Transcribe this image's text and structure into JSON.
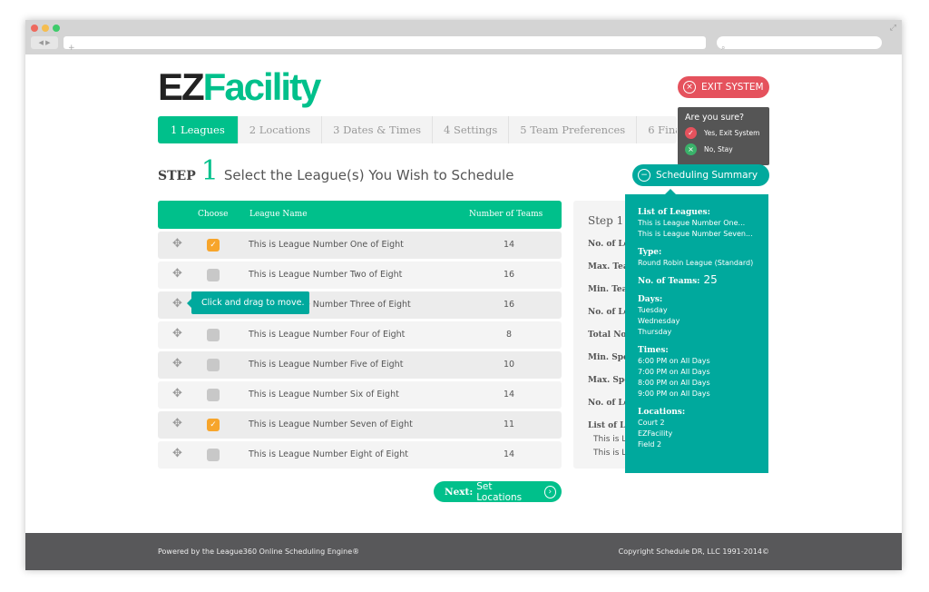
{
  "browser": {
    "back": "◀",
    "forward": "▶",
    "new_tab": "+",
    "search_icon": "search-icon"
  },
  "brand": {
    "logo_part1": "EZ",
    "logo_part2": "Facility",
    "color_dark": "#222222",
    "color_green": "#00c08b"
  },
  "exit": {
    "label": "EXIT SYSTEM",
    "color": "#e5525d",
    "confirm_title": "Are you sure?",
    "yes": "Yes, Exit System",
    "no": "No, Stay"
  },
  "steps": [
    {
      "label": "1 Leagues",
      "active": true
    },
    {
      "label": "2 Locations"
    },
    {
      "label": "3 Dates & Times"
    },
    {
      "label": "4 Settings"
    },
    {
      "label": "5 Team Preferences"
    },
    {
      "label": "6 Finalize"
    }
  ],
  "heading": {
    "step": "STEP",
    "number": "1",
    "title": "Select the League(s) You Wish to Schedule"
  },
  "table": {
    "headers": {
      "choose": "Choose",
      "name": "League Name",
      "teams": "Number of Teams"
    },
    "rows": [
      {
        "name": "This is League Number One of Eight",
        "teams": "14",
        "checked": true
      },
      {
        "name": "This is League Number Two of Eight",
        "teams": "16",
        "checked": false
      },
      {
        "name": "This is League Number Three of Eight",
        "teams": "16",
        "checked": false
      },
      {
        "name": "This is League Number Four of Eight",
        "teams": "8",
        "checked": false
      },
      {
        "name": "This is League Number Five of Eight",
        "teams": "10",
        "checked": false
      },
      {
        "name": "This is League Number Six of Eight",
        "teams": "14",
        "checked": false
      },
      {
        "name": "This is League Number Seven of Eight",
        "teams": "11",
        "checked": true
      },
      {
        "name": "This is League Number Eight of Eight",
        "teams": "14",
        "checked": false
      }
    ],
    "tooltip": "Click and drag to move."
  },
  "step_panel": {
    "title": "Step 1",
    "labels": [
      "No. of Le",
      "Max. Tea",
      "Min. Tea",
      "No. of Le",
      "Total No.",
      "Min. Spo",
      "Max. Spo",
      "No. of Le",
      "List of Le"
    ],
    "items": [
      "This is L",
      "This is L"
    ]
  },
  "summary": {
    "button": "Scheduling Summary",
    "leagues_label": "List of Leagues:",
    "leagues": [
      "This is League Number One...",
      "This is League Number Seven..."
    ],
    "type_label": "Type:",
    "type": "Round Robin League (Standard)",
    "teams_label": "No. of Teams:",
    "teams": "25",
    "days_label": "Days:",
    "days": [
      "Tuesday",
      "Wednesday",
      "Thursday"
    ],
    "times_label": "Times:",
    "times": [
      "6:00 PM on All Days",
      "7:00 PM on All Days",
      "8:00 PM on All Days",
      "9:00 PM on All Days"
    ],
    "locations_label": "Locations:",
    "locations": [
      "Court 2",
      "EZFacility",
      "Field 2"
    ]
  },
  "next": {
    "bold": "Next:",
    "label": "Set Locations"
  },
  "footer": {
    "left": "Powered by the League360 Online Scheduling Engine®",
    "right": "Copyright Schedule DR, LLC 1991-2014©"
  }
}
